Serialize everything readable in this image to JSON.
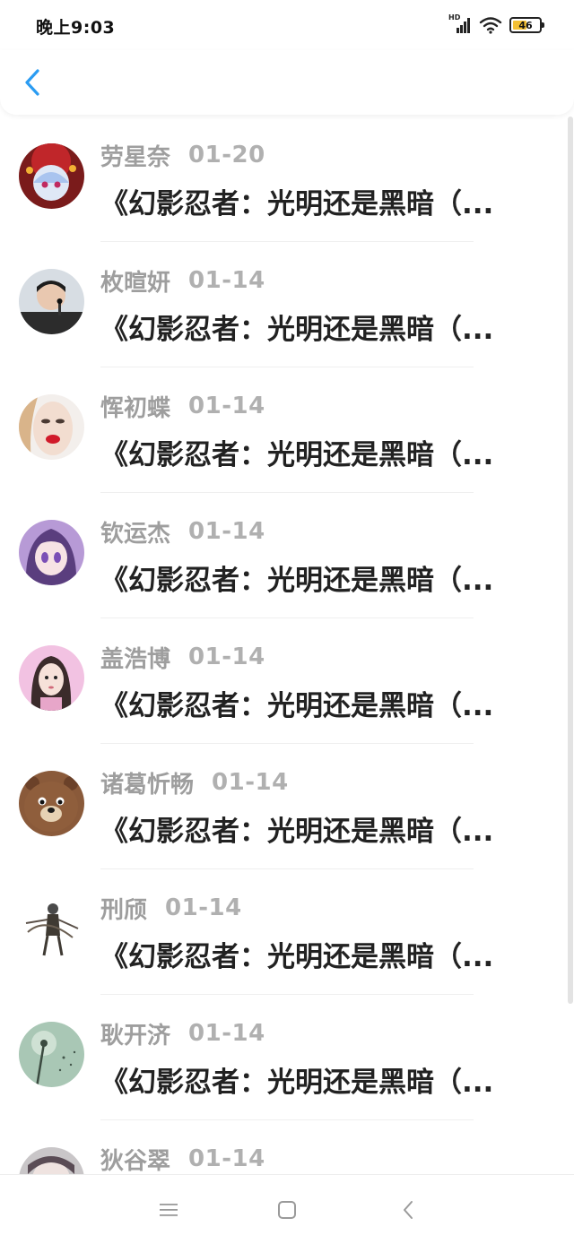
{
  "status_bar": {
    "time": "晚上9:03",
    "network": "HD",
    "battery": "46"
  },
  "comments": [
    {
      "name": "劳星奈",
      "date": "01-20",
      "title": "《幻影忍者：光明还是黑暗（..."
    },
    {
      "name": "枚暄妍",
      "date": "01-14",
      "title": "《幻影忍者：光明还是黑暗（..."
    },
    {
      "name": "恽初蝶",
      "date": "01-14",
      "title": "《幻影忍者：光明还是黑暗（..."
    },
    {
      "name": "钦运杰",
      "date": "01-14",
      "title": "《幻影忍者：光明还是黑暗（..."
    },
    {
      "name": "盖浩博",
      "date": "01-14",
      "title": "《幻影忍者：光明还是黑暗（..."
    },
    {
      "name": "诸葛忻畅",
      "date": "01-14",
      "title": "《幻影忍者：光明还是黑暗（..."
    },
    {
      "name": "刑颀",
      "date": "01-14",
      "title": "《幻影忍者：光明还是黑暗（..."
    },
    {
      "name": "耿开济",
      "date": "01-14",
      "title": "《幻影忍者：光明还是黑暗（..."
    },
    {
      "name": "狄谷翠",
      "date": "01-14",
      "title": ""
    }
  ],
  "icons": {
    "back": "chevron-left-icon",
    "menu": "menu-icon",
    "home": "home-square-icon",
    "nav_back": "back-triangle-icon"
  },
  "colors": {
    "accent": "#2b9cf2",
    "name_text": "#9e9e9e",
    "title_text": "#222222",
    "battery_fill": "#f4c033"
  }
}
